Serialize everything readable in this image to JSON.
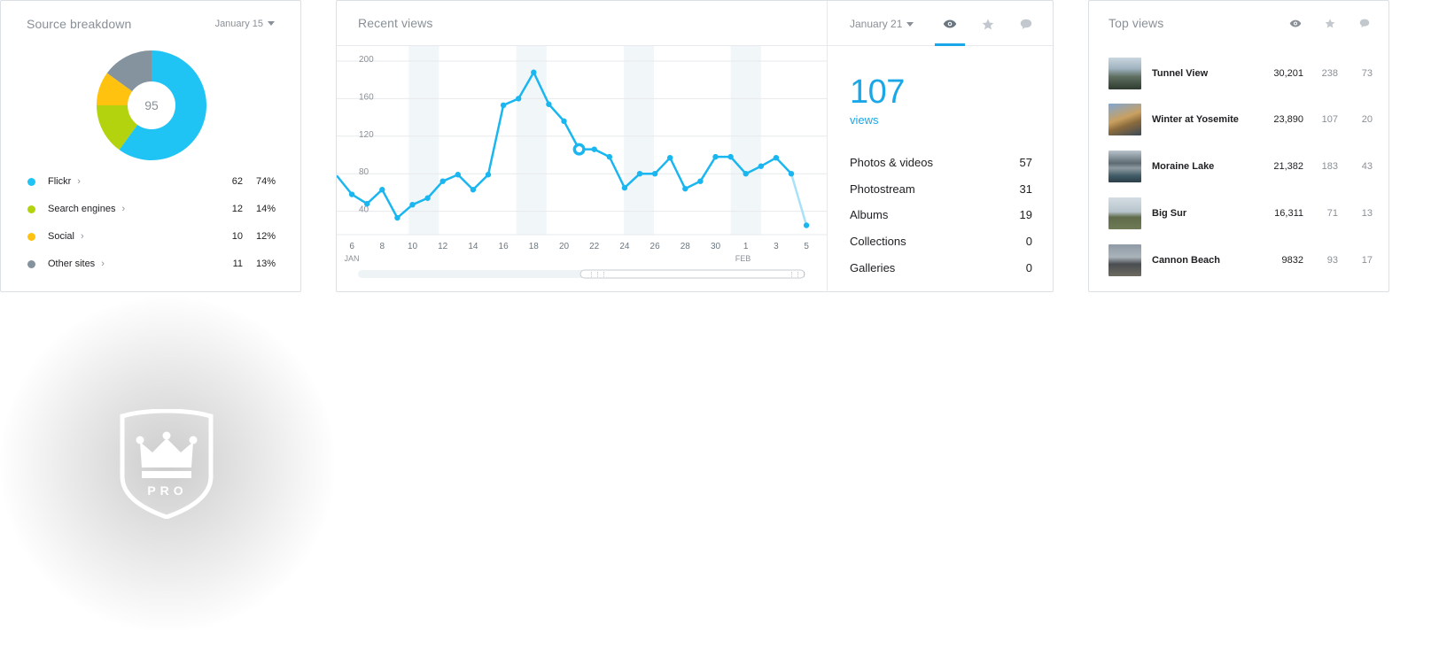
{
  "source_breakdown": {
    "title": "Source breakdown",
    "date": "January 15",
    "total": "95",
    "items": [
      {
        "label": "Flickr",
        "count": "62",
        "pct": "74%",
        "color": "#20c4f4"
      },
      {
        "label": "Search engines",
        "count": "12",
        "pct": "14%",
        "color": "#b4d30f"
      },
      {
        "label": "Social",
        "count": "10",
        "pct": "12%",
        "color": "#ffc20e"
      },
      {
        "label": "Other sites",
        "count": "11",
        "pct": "13%",
        "color": "#84939e"
      }
    ],
    "donut_fractions": [
      0.6,
      0.15,
      0.1,
      0.15
    ]
  },
  "recent_views": {
    "title": "Recent views",
    "date": "January 21",
    "tabs": [
      "eye-icon",
      "star-icon",
      "comment-icon"
    ],
    "active_tab": "eye-icon",
    "total": "107",
    "total_label": "views",
    "stats": [
      {
        "label": "Photos & videos",
        "value": "57"
      },
      {
        "label": "Photostream",
        "value": "31"
      },
      {
        "label": "Albums",
        "value": "19"
      },
      {
        "label": "Collections",
        "value": "0"
      },
      {
        "label": "Galleries",
        "value": "0"
      }
    ]
  },
  "chart_data": {
    "type": "line",
    "yticks": [
      "200",
      "160",
      "120",
      "80",
      "40"
    ],
    "xticks": [
      "6",
      "8",
      "10",
      "12",
      "14",
      "16",
      "18",
      "20",
      "22",
      "24",
      "26",
      "28",
      "30",
      "1",
      "3",
      "5"
    ],
    "month_labels": [
      "JAN",
      "FEB"
    ],
    "ylim": [
      0,
      210
    ],
    "x": [
      "Jan 5",
      "Jan 6",
      "Jan 7",
      "Jan 8",
      "Jan 9",
      "Jan 10",
      "Jan 11",
      "Jan 12",
      "Jan 13",
      "Jan 14",
      "Jan 15",
      "Jan 16",
      "Jan 17",
      "Jan 18",
      "Jan 19",
      "Jan 20",
      "Jan 21",
      "Jan 22",
      "Jan 23",
      "Jan 24",
      "Jan 25",
      "Jan 26",
      "Jan 27",
      "Jan 28",
      "Jan 29",
      "Jan 30",
      "Jan 31",
      "Feb 1",
      "Feb 2",
      "Feb 3",
      "Feb 4",
      "Feb 5"
    ],
    "values": [
      78,
      58,
      48,
      63,
      33,
      47,
      54,
      72,
      79,
      63,
      79,
      153,
      160,
      188,
      154,
      136,
      106,
      106,
      98,
      65,
      80,
      80,
      97,
      64,
      72,
      98,
      98,
      80,
      88,
      97,
      80,
      25
    ],
    "highlight_index": 16,
    "grid": true
  },
  "top_views": {
    "title": "Top views",
    "columns": [
      "eye-icon",
      "star-icon",
      "comment-icon"
    ],
    "photos": [
      {
        "title": "Tunnel View",
        "views": "30,201",
        "faves": "238",
        "comments": "73"
      },
      {
        "title": "Winter at Yosemite",
        "views": "23,890",
        "faves": "107",
        "comments": "20"
      },
      {
        "title": "Moraine Lake",
        "views": "21,382",
        "faves": "183",
        "comments": "43"
      },
      {
        "title": "Big Sur",
        "views": "16,311",
        "faves": "71",
        "comments": "13"
      },
      {
        "title": "Cannon Beach",
        "views": "9832",
        "faves": "93",
        "comments": "17"
      }
    ]
  },
  "pro_badge": {
    "label": "PRO"
  }
}
